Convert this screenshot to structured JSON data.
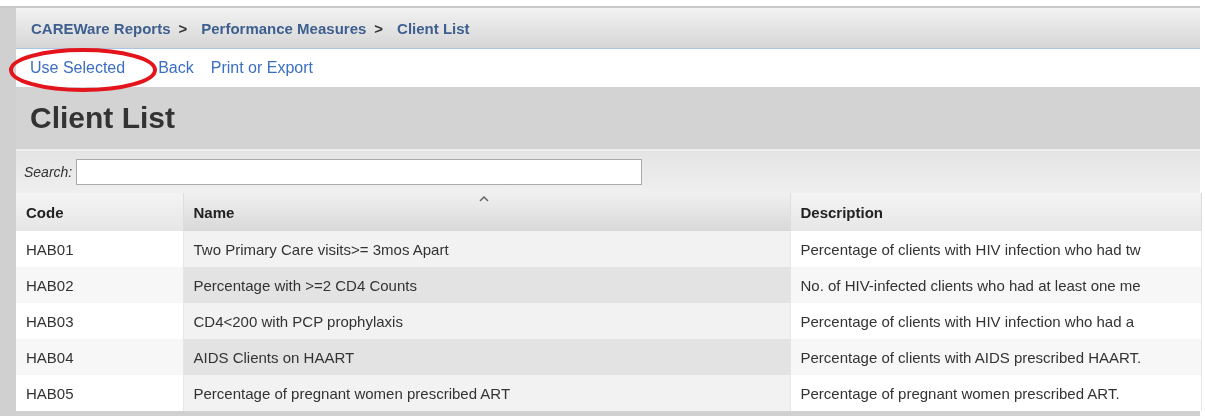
{
  "breadcrumb": [
    {
      "label": "CAREWare Reports"
    },
    {
      "label": "Performance Measures"
    },
    {
      "label": "Client List"
    }
  ],
  "breadcrumb_separator": ">",
  "actions": [
    {
      "label": "Use Selected",
      "highlighted": true
    },
    {
      "label": "Back",
      "highlighted": false
    },
    {
      "label": "Print or Export",
      "highlighted": false
    }
  ],
  "title": "Client List",
  "search": {
    "label": "Search:"
  },
  "table": {
    "columns": [
      {
        "label": "Code",
        "sorted": false
      },
      {
        "label": "Name",
        "sorted": true
      },
      {
        "label": "Description",
        "sorted": false
      }
    ],
    "rows": [
      [
        "HAB01",
        "Two Primary Care visits>= 3mos Apart",
        "Percentage of clients with HIV infection who had tw"
      ],
      [
        "HAB02",
        "Percentage with >=2 CD4 Counts",
        "No. of HIV-infected clients who had at least one me"
      ],
      [
        "HAB03",
        "CD4<200 with PCP prophylaxis",
        "Percentage of clients with HIV infection who had a"
      ],
      [
        "HAB04",
        "AIDS Clients on HAART",
        "Percentage of clients with AIDS prescribed HAART."
      ],
      [
        "HAB05",
        "Percentage of pregnant women prescribed ART",
        "Percentage of pregnant women prescribed ART."
      ]
    ]
  }
}
